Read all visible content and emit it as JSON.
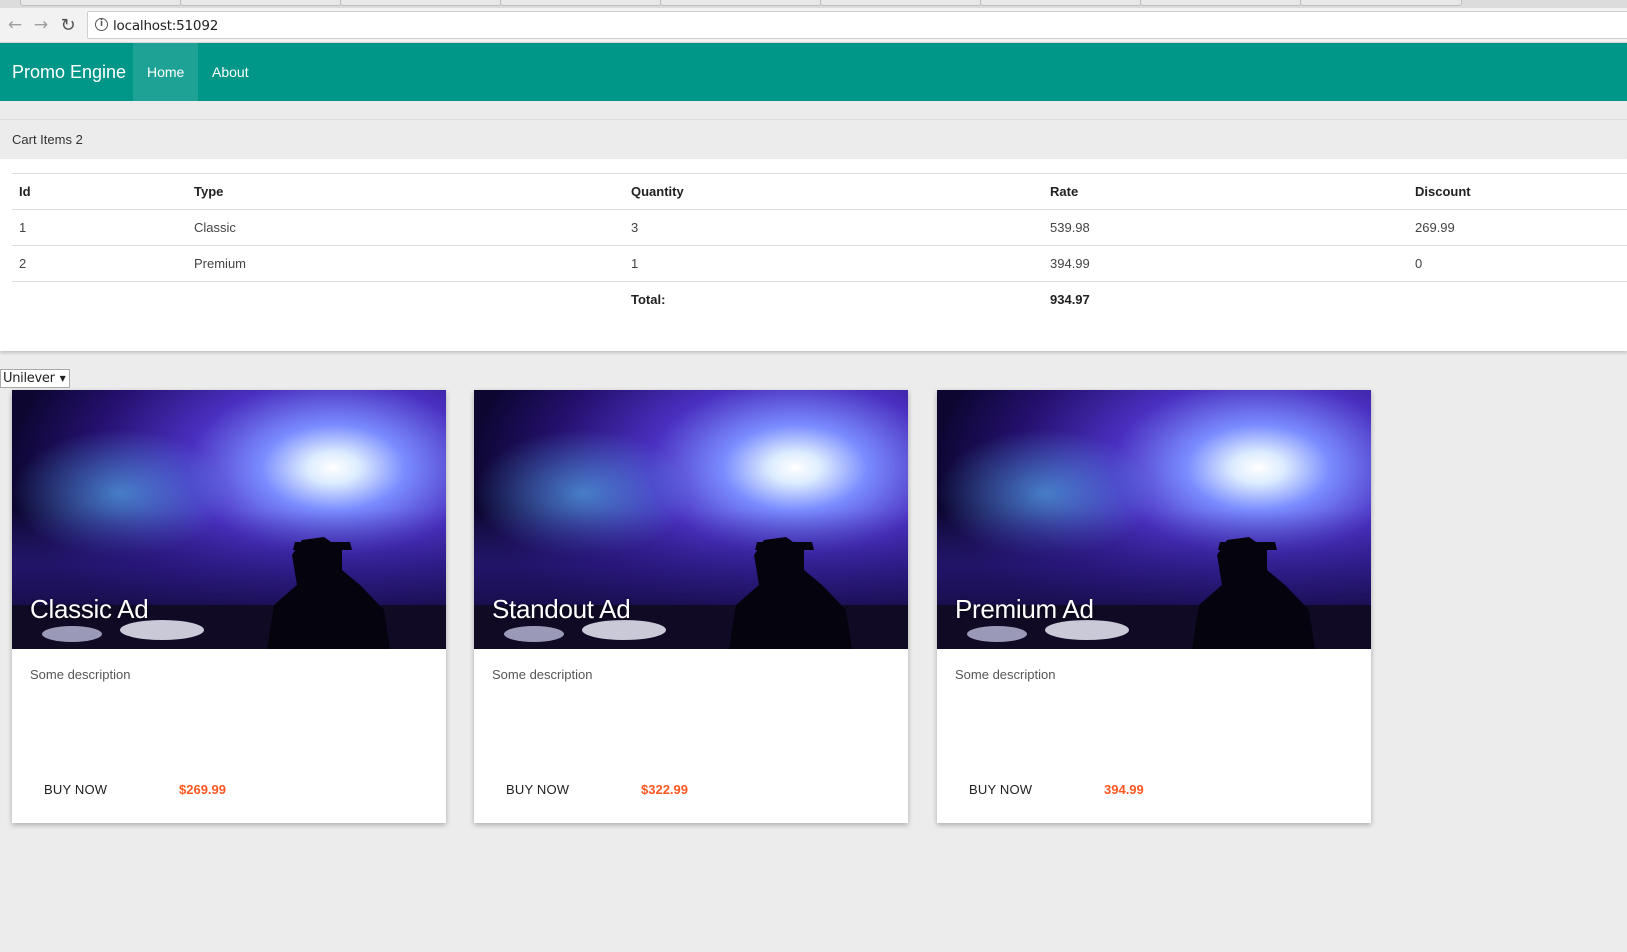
{
  "browser": {
    "url": "localhost:51092"
  },
  "navbar": {
    "brand": "Promo Engine",
    "items": [
      {
        "label": "Home",
        "active": true
      },
      {
        "label": "About",
        "active": false
      }
    ],
    "color": "#009688"
  },
  "cart": {
    "header": "Cart Items 2",
    "columns": [
      "Id",
      "Type",
      "Quantity",
      "Rate",
      "Discount"
    ],
    "rows": [
      {
        "id": "1",
        "type": "Classic",
        "quantity": "3",
        "rate": "539.98",
        "discount": "269.99"
      },
      {
        "id": "2",
        "type": "Premium",
        "quantity": "1",
        "rate": "394.99",
        "discount": "0"
      }
    ],
    "total_label": "Total:",
    "total_value": "934.97"
  },
  "client_select": {
    "selected": "Unilever"
  },
  "products": [
    {
      "title": "Classic Ad",
      "description": "Some description",
      "button": "BUY NOW",
      "price": "$269.99"
    },
    {
      "title": "Standout Ad",
      "description": "Some description",
      "button": "BUY NOW",
      "price": "$322.99"
    },
    {
      "title": "Premium Ad",
      "description": "Some description",
      "button": "BUY NOW",
      "price": "394.99"
    }
  ],
  "colors": {
    "accent": "#009688",
    "price": "#ff5722"
  }
}
